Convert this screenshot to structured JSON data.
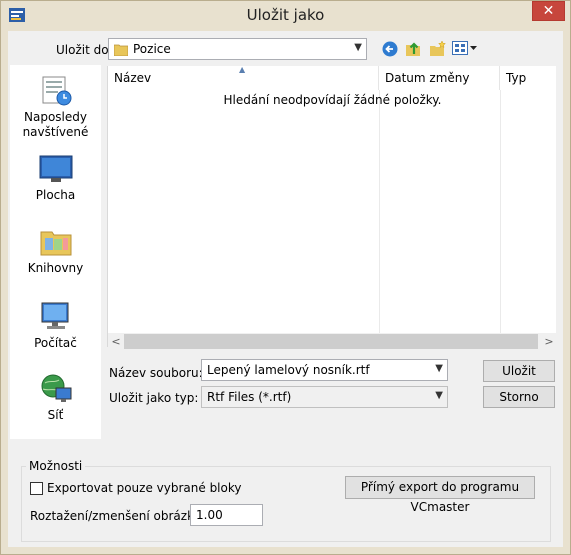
{
  "window": {
    "title": "Uložit jako",
    "close_glyph": "✕"
  },
  "location": {
    "label": "Uložit do:",
    "value": "Pozice"
  },
  "toolbar_icons": [
    "back-icon",
    "up-folder-icon",
    "new-folder-icon",
    "view-menu-icon"
  ],
  "places": [
    {
      "label": "Naposledy navštívené",
      "icon": "recent-places-icon"
    },
    {
      "label": "Plocha",
      "icon": "desktop-icon"
    },
    {
      "label": "Knihovny",
      "icon": "libraries-icon"
    },
    {
      "label": "Počítač",
      "icon": "computer-icon"
    },
    {
      "label": "Síť",
      "icon": "network-icon"
    }
  ],
  "file_list": {
    "columns": [
      "Název",
      "Datum změny",
      "Typ"
    ],
    "empty_message": "Hledání neodpovídají žádné položky."
  },
  "filename": {
    "label": "Název souboru:",
    "value": "Lepený lamelový nosník.rtf"
  },
  "filetype": {
    "label": "Uložit jako typ:",
    "value": "Rtf Files (*.rtf)"
  },
  "buttons": {
    "save": "Uložit",
    "cancel": "Storno"
  },
  "options": {
    "group_label": "Možnosti",
    "export_selected_label": "Exportovat pouze vybrané bloky",
    "export_selected_checked": false,
    "direct_export_label": "Přímý export do programu VCmaster",
    "scale_label": "Roztažení/zmenšení obrázků:",
    "scale_value": "1.00"
  },
  "colors": {
    "frame": "#e8e1cf",
    "close_button": "#c7463c",
    "client": "#f0f0f0"
  }
}
